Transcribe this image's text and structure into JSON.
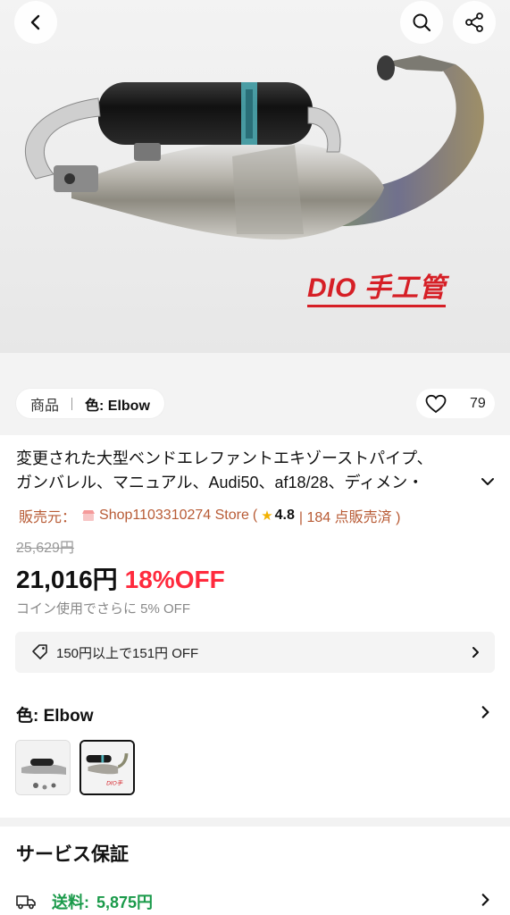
{
  "hero": {
    "caption": "DIO 手工管",
    "tab_label": "商品",
    "variant_label": "色: Elbow",
    "like_count": "79"
  },
  "product": {
    "title_line1": "変更された大型ベンドエレファントエキゾーストパイプ、",
    "title_line2": "ガンバレル、マニュアル、Audi50、af18/28、ディメン・",
    "seller_prefix": "販売元：",
    "seller_name": "Shop1103310274 Store",
    "seller_open": "(",
    "rating": "4.8",
    "sold_text": "| 184 点販売済 )",
    "original_price": "25,629円",
    "price": "21,016円",
    "discount": "18%OFF",
    "coin_note": "コイン使用でさらに 5% OFF",
    "coupon_text": "150円以上で151円 OFF"
  },
  "color_section": {
    "label": "色: Elbow"
  },
  "service": {
    "title": "サービス保証",
    "shipping_label": "送料:",
    "shipping_value": "5,875円"
  },
  "colors": {
    "seller_brown": "#b85b35",
    "discount_red": "#ff2a3d",
    "shipping_green": "#1a9a4a",
    "caption_red": "#d61f26"
  },
  "icons": [
    "back-arrow-icon",
    "search-icon",
    "share-icon",
    "heart-icon",
    "chevron-down-icon",
    "store-icon",
    "star-icon",
    "coupon-tag-icon",
    "chevron-right-icon",
    "truck-icon"
  ]
}
